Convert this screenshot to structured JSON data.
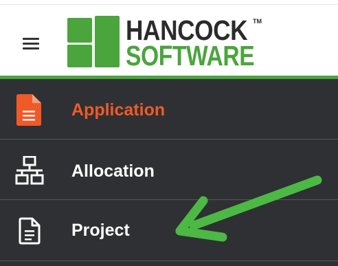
{
  "logo": {
    "line1": "HANCOCK",
    "trademark": "TM",
    "line2": "SOFTWARE",
    "brand_green": "#4aa53c"
  },
  "menu_icon": "hamburger-icon",
  "nav": {
    "accent_color": "#ef5a28",
    "items": [
      {
        "label": "Application",
        "icon": "document-icon",
        "active": true
      },
      {
        "label": "Allocation",
        "icon": "network-icon",
        "active": false
      },
      {
        "label": "Project",
        "icon": "file-text-icon",
        "active": false
      }
    ]
  },
  "annotation": {
    "type": "green-arrow",
    "color": "#4cb944",
    "points_to": "Project"
  }
}
